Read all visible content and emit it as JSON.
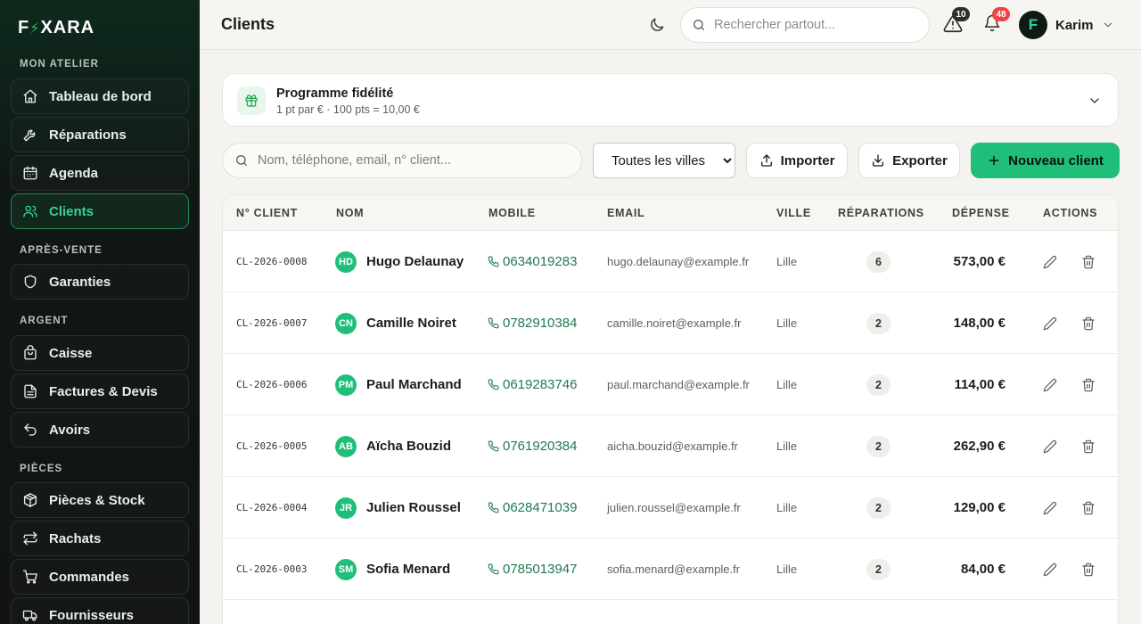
{
  "brand": {
    "logo_left": "F",
    "logo_right": "XARA"
  },
  "sidebar": {
    "sections": [
      {
        "title": "MON ATELIER",
        "items": [
          {
            "label": "Tableau de bord",
            "icon": "home-icon"
          },
          {
            "label": "Réparations",
            "icon": "wrench-icon"
          },
          {
            "label": "Agenda",
            "icon": "calendar-icon"
          },
          {
            "label": "Clients",
            "icon": "users-icon",
            "active": true
          }
        ]
      },
      {
        "title": "APRÈS-VENTE",
        "items": [
          {
            "label": "Garanties",
            "icon": "shield-icon"
          }
        ]
      },
      {
        "title": "ARGENT",
        "items": [
          {
            "label": "Caisse",
            "icon": "register-icon"
          },
          {
            "label": "Factures & Devis",
            "icon": "document-icon"
          },
          {
            "label": "Avoirs",
            "icon": "undo-icon"
          }
        ]
      },
      {
        "title": "PIÈCES",
        "items": [
          {
            "label": "Pièces & Stock",
            "icon": "box-icon"
          },
          {
            "label": "Rachats",
            "icon": "swap-icon"
          },
          {
            "label": "Commandes",
            "icon": "cart-icon"
          },
          {
            "label": "Fournisseurs",
            "icon": "truck-icon"
          }
        ]
      }
    ]
  },
  "header": {
    "title": "Clients",
    "search_placeholder": "Rechercher partout...",
    "alerts_count": "10",
    "notifications_count": "48",
    "user_initial": "F",
    "user_name": "Karim"
  },
  "loyalty": {
    "title": "Programme fidélité",
    "subtitle": "1 pt par € · 100 pts = 10,00 €"
  },
  "toolbar": {
    "search_placeholder": "Nom, téléphone, email, n° client...",
    "city_selected": "Toutes les villes",
    "import_label": "Importer",
    "export_label": "Exporter",
    "new_label": "Nouveau client"
  },
  "table": {
    "headers": {
      "num": "N° CLIENT",
      "name": "NOM",
      "mobile": "MOBILE",
      "email": "EMAIL",
      "city": "VILLE",
      "repairs": "RÉPARATIONS",
      "spend": "DÉPENSE",
      "actions": "ACTIONS"
    },
    "rows": [
      {
        "num": "CL-2026-0008",
        "initials": "HD",
        "name": "Hugo Delaunay",
        "mobile": "0634019283",
        "email": "hugo.delaunay@example.fr",
        "city": "Lille",
        "repairs": "6",
        "spend": "573,00 €"
      },
      {
        "num": "CL-2026-0007",
        "initials": "CN",
        "name": "Camille Noiret",
        "mobile": "0782910384",
        "email": "camille.noiret@example.fr",
        "city": "Lille",
        "repairs": "2",
        "spend": "148,00 €"
      },
      {
        "num": "CL-2026-0006",
        "initials": "PM",
        "name": "Paul Marchand",
        "mobile": "0619283746",
        "email": "paul.marchand@example.fr",
        "city": "Lille",
        "repairs": "2",
        "spend": "114,00 €"
      },
      {
        "num": "CL-2026-0005",
        "initials": "AB",
        "name": "Aïcha Bouzid",
        "mobile": "0761920384",
        "email": "aicha.bouzid@example.fr",
        "city": "Lille",
        "repairs": "2",
        "spend": "262,90 €"
      },
      {
        "num": "CL-2026-0004",
        "initials": "JR",
        "name": "Julien Roussel",
        "mobile": "0628471039",
        "email": "julien.roussel@example.fr",
        "city": "Lille",
        "repairs": "2",
        "spend": "129,00 €"
      },
      {
        "num": "CL-2026-0003",
        "initials": "SM",
        "name": "Sofia Menard",
        "mobile": "0785013947",
        "email": "sofia.menard@example.fr",
        "city": "Lille",
        "repairs": "2",
        "spend": "84,00 €"
      }
    ]
  }
}
